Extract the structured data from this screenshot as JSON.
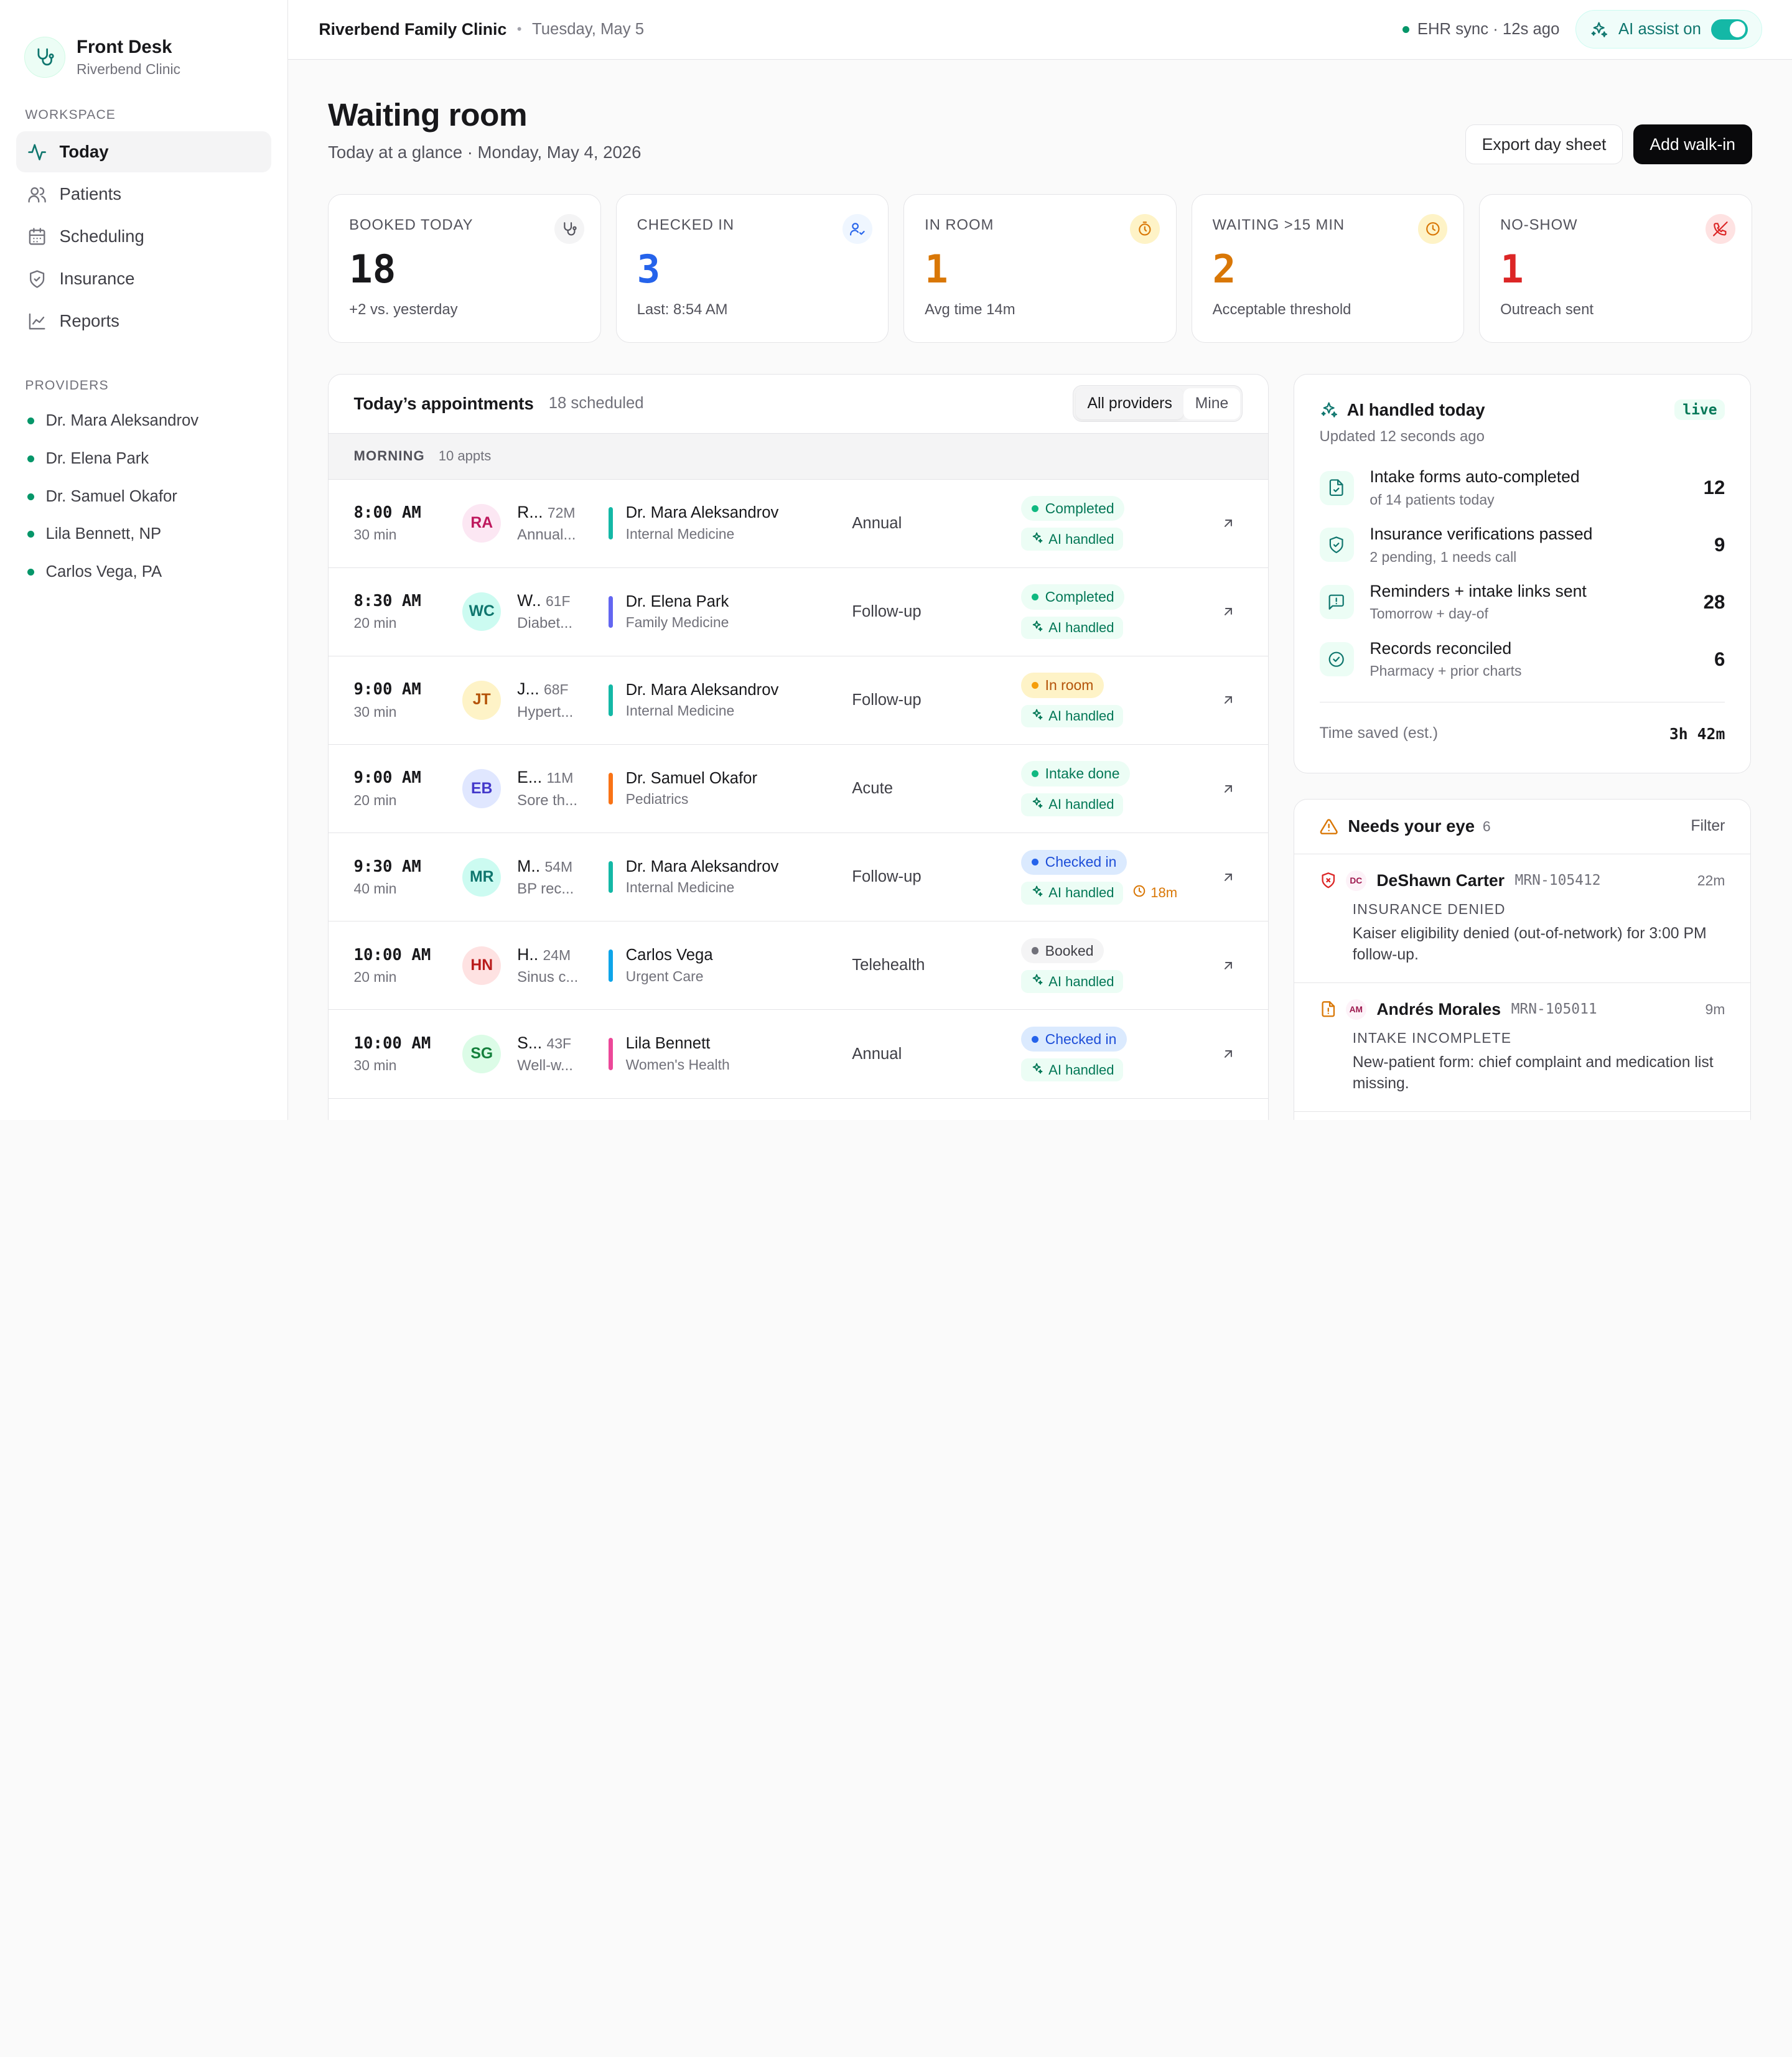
{
  "brand": {
    "name": "Front Desk",
    "sub": "Riverbend Clinic"
  },
  "sidebar": {
    "workspace_label": "WORKSPACE",
    "items": [
      {
        "label": "Today",
        "icon": "activity-icon",
        "active": true
      },
      {
        "label": "Patients",
        "icon": "users-icon"
      },
      {
        "label": "Scheduling",
        "icon": "calendar-icon"
      },
      {
        "label": "Insurance",
        "icon": "shield-icon"
      },
      {
        "label": "Reports",
        "icon": "chart-line-icon"
      }
    ],
    "providers_label": "PROVIDERS",
    "providers": [
      "Dr. Mara Aleksandrov",
      "Dr. Elena Park",
      "Dr. Samuel Okafor",
      "Lila Bennett, NP",
      "Carlos Vega, PA"
    ]
  },
  "topbar": {
    "clinic": "Riverbend Family Clinic",
    "date": "Tuesday, May 5",
    "sync": "EHR sync · 12s ago",
    "ai_assist": "AI assist on"
  },
  "page": {
    "title": "Waiting room",
    "subtitle": "Today at a glance · Monday, May 4, 2026",
    "export": "Export day sheet",
    "add": "Add walk-in"
  },
  "kpis": [
    {
      "label": "BOOKED TODAY",
      "value": "18",
      "note": "+2 vs. yesterday",
      "color": "#18181b",
      "icon": "stethoscope-icon",
      "icon_bg": "#f4f4f5",
      "icon_color": "#52525b"
    },
    {
      "label": "CHECKED IN",
      "value": "3",
      "note": "Last: 8:54 AM",
      "color": "#2563eb",
      "icon": "user-check-icon",
      "icon_bg": "#eff6ff",
      "icon_color": "#2563eb"
    },
    {
      "label": "IN ROOM",
      "value": "1",
      "note": "Avg time 14m",
      "color": "#d97706",
      "icon": "timer-icon",
      "icon_bg": "#fef3c7",
      "icon_color": "#d97706"
    },
    {
      "label": "WAITING >15 MIN",
      "value": "2",
      "note": "Acceptable threshold",
      "color": "#d97706",
      "icon": "clock-icon",
      "icon_bg": "#fef3c7",
      "icon_color": "#d97706"
    },
    {
      "label": "NO-SHOW",
      "value": "1",
      "note": "Outreach sent",
      "color": "#dc2626",
      "icon": "phone-off-icon",
      "icon_bg": "#fee2e2",
      "icon_color": "#dc2626"
    }
  ],
  "appointments": {
    "title": "Today’s appointments",
    "count": "18 scheduled",
    "filter_all": "All providers",
    "filter_mine": "Mine",
    "group_label": "MORNING",
    "group_count": "10 appts",
    "ai_label": "AI handled",
    "rows": [
      {
        "time": "8:00 AM",
        "dur": "30 min",
        "initials": "RA",
        "name": "R...",
        "age": "72M",
        "reason": "Annual...",
        "av_bg": "#fce7f3",
        "av_fg": "#be185d",
        "bar": "#14b8a6",
        "provider": "Dr. Mara Aleksandrov",
        "spec": "Internal Medicine",
        "visit": "Annual",
        "status": "Completed",
        "st_bg": "#ecfdf5",
        "st_fg": "#047857",
        "st_dot": "#10b981",
        "wait": ""
      },
      {
        "time": "8:30 AM",
        "dur": "20 min",
        "initials": "WC",
        "name": "W..",
        "age": "61F",
        "reason": "Diabet...",
        "av_bg": "#ccfbf1",
        "av_fg": "#0f766e",
        "bar": "#6366f1",
        "provider": "Dr. Elena Park",
        "spec": "Family Medicine",
        "visit": "Follow-up",
        "status": "Completed",
        "st_bg": "#ecfdf5",
        "st_fg": "#047857",
        "st_dot": "#10b981",
        "wait": ""
      },
      {
        "time": "9:00 AM",
        "dur": "30 min",
        "initials": "JT",
        "name": "J...",
        "age": "68F",
        "reason": "Hypert...",
        "av_bg": "#fef3c7",
        "av_fg": "#b45309",
        "bar": "#14b8a6",
        "provider": "Dr. Mara Aleksandrov",
        "spec": "Internal Medicine",
        "visit": "Follow-up",
        "status": "In room",
        "st_bg": "#fef3c7",
        "st_fg": "#b45309",
        "st_dot": "#f59e0b",
        "wait": ""
      },
      {
        "time": "9:00 AM",
        "dur": "20 min",
        "initials": "EB",
        "name": "E...",
        "age": "11M",
        "reason": "Sore th...",
        "av_bg": "#e0e7ff",
        "av_fg": "#4338ca",
        "bar": "#f97316",
        "provider": "Dr. Samuel Okafor",
        "spec": "Pediatrics",
        "visit": "Acute",
        "status": "Intake done",
        "st_bg": "#ecfdf5",
        "st_fg": "#047857",
        "st_dot": "#10b981",
        "wait": ""
      },
      {
        "time": "9:30 AM",
        "dur": "40 min",
        "initials": "MR",
        "name": "M..",
        "age": "54M",
        "reason": "BP rec...",
        "av_bg": "#ccfbf1",
        "av_fg": "#0f766e",
        "bar": "#14b8a6",
        "provider": "Dr. Mara Aleksandrov",
        "spec": "Internal Medicine",
        "visit": "Follow-up",
        "status": "Checked in",
        "st_bg": "#dbeafe",
        "st_fg": "#1d4ed8",
        "st_dot": "#2563eb",
        "wait": "18m"
      },
      {
        "time": "10:00 AM",
        "dur": "20 min",
        "initials": "HN",
        "name": "H..",
        "age": "24M",
        "reason": "Sinus c...",
        "av_bg": "#fee2e2",
        "av_fg": "#b91c1c",
        "bar": "#0ea5e9",
        "provider": "Carlos Vega",
        "spec": "Urgent Care",
        "visit": "Telehealth",
        "status": "Booked",
        "st_bg": "#f4f4f5",
        "st_fg": "#3f3f46",
        "st_dot": "#71717a",
        "wait": ""
      },
      {
        "time": "10:00 AM",
        "dur": "30 min",
        "initials": "SG",
        "name": "S...",
        "age": "43F",
        "reason": "Well-w...",
        "av_bg": "#dcfce7",
        "av_fg": "#15803d",
        "bar": "#ec4899",
        "provider": "Lila Bennett",
        "spec": "Women's Health",
        "visit": "Annual",
        "status": "Checked in",
        "st_bg": "#dbeafe",
        "st_fg": "#1d4ed8",
        "st_dot": "#2563eb",
        "wait": ""
      }
    ]
  },
  "ai_card": {
    "title": "AI handled today",
    "live": "live",
    "updated": "Updated 12 seconds ago",
    "items": [
      {
        "main": "Intake forms auto-completed",
        "sub": "of 14 patients today",
        "num": "12",
        "icon": "file-check-icon"
      },
      {
        "main": "Insurance verifications passed",
        "sub": "2 pending, 1 needs call",
        "num": "9",
        "icon": "shield-check-icon"
      },
      {
        "main": "Reminders + intake links sent",
        "sub": "Tomorrow + day-of",
        "num": "28",
        "icon": "message-icon"
      },
      {
        "main": "Records reconciled",
        "sub": "Pharmacy + prior charts",
        "num": "6",
        "icon": "circle-check-icon"
      }
    ],
    "saved_label": "Time saved (est.)",
    "saved_value": "3h 42m"
  },
  "needs_eye": {
    "title": "Needs your eye",
    "count": "6",
    "filter": "Filter",
    "items": [
      {
        "initials": "DC",
        "name": "DeShawn Carter",
        "mrn": "MRN-105412",
        "time": "22m",
        "kind": "INSURANCE DENIED",
        "desc": "Kaiser eligibility denied (out-of-network) for 3:00 PM follow-up.",
        "icon": "shield-alert-icon",
        "icon_color": "#dc2626"
      },
      {
        "initials": "AM",
        "name": "Andrés Morales",
        "mrn": "MRN-105011",
        "time": "9m",
        "kind": "INTAKE INCOMPLETE",
        "desc": "New-patient form: chief complaint and medication list missing.",
        "icon": "file-alert-icon",
        "icon_color": "#d97706"
      }
    ]
  }
}
